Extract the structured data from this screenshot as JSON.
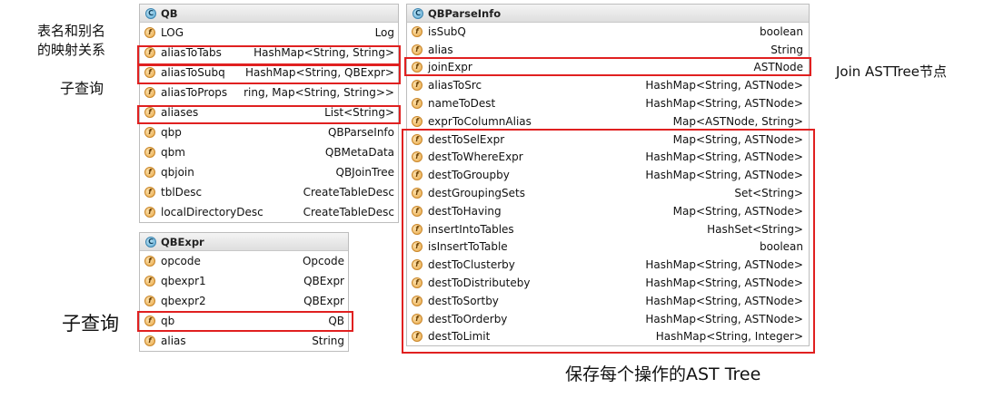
{
  "annotations": {
    "alias_mapping": [
      "表名和别名",
      "的映射关系"
    ],
    "subquery_top": "子查询",
    "subquery_bottom": "子查询",
    "join_node": "Join ASTTree节点",
    "save_each_op": "保存每个操作的AST Tree"
  },
  "panels": {
    "qb": {
      "title": "QB",
      "fields": [
        {
          "name": "LOG",
          "type": "Log"
        },
        {
          "name": "aliasToTabs",
          "type": "HashMap<String, String>"
        },
        {
          "name": "aliasToSubq",
          "type": "HashMap<String, QBExpr>"
        },
        {
          "name": "aliasToProps",
          "type": "ring, Map<String, String>>"
        },
        {
          "name": "aliases",
          "type": "List<String>"
        },
        {
          "name": "qbp",
          "type": "QBParseInfo"
        },
        {
          "name": "qbm",
          "type": "QBMetaData"
        },
        {
          "name": "qbjoin",
          "type": "QBJoinTree"
        },
        {
          "name": "tblDesc",
          "type": "CreateTableDesc"
        },
        {
          "name": "localDirectoryDesc",
          "type": "CreateTableDesc"
        }
      ]
    },
    "qbexpr": {
      "title": "QBExpr",
      "fields": [
        {
          "name": "opcode",
          "type": "Opcode"
        },
        {
          "name": "qbexpr1",
          "type": "QBExpr"
        },
        {
          "name": "qbexpr2",
          "type": "QBExpr"
        },
        {
          "name": "qb",
          "type": "QB"
        },
        {
          "name": "alias",
          "type": "String"
        }
      ]
    },
    "qbparseinfo": {
      "title": "QBParseInfo",
      "fields": [
        {
          "name": "isSubQ",
          "type": "boolean"
        },
        {
          "name": "alias",
          "type": "String"
        },
        {
          "name": "joinExpr",
          "type": "ASTNode"
        },
        {
          "name": "aliasToSrc",
          "type": "HashMap<String, ASTNode>"
        },
        {
          "name": "nameToDest",
          "type": "HashMap<String, ASTNode>"
        },
        {
          "name": "exprToColumnAlias",
          "type": "Map<ASTNode, String>"
        },
        {
          "name": "destToSelExpr",
          "type": "Map<String, ASTNode>"
        },
        {
          "name": "destToWhereExpr",
          "type": "HashMap<String, ASTNode>"
        },
        {
          "name": "destToGroupby",
          "type": "HashMap<String, ASTNode>"
        },
        {
          "name": "destGroupingSets",
          "type": "Set<String>"
        },
        {
          "name": "destToHaving",
          "type": "Map<String, ASTNode>"
        },
        {
          "name": "insertIntoTables",
          "type": "HashSet<String>"
        },
        {
          "name": "isInsertToTable",
          "type": "boolean"
        },
        {
          "name": "destToClusterby",
          "type": "HashMap<String, ASTNode>"
        },
        {
          "name": "destToDistributeby",
          "type": "HashMap<String, ASTNode>"
        },
        {
          "name": "destToSortby",
          "type": "HashMap<String, ASTNode>"
        },
        {
          "name": "destToOrderby",
          "type": "HashMap<String, ASTNode>"
        },
        {
          "name": "destToLimit",
          "type": "HashMap<String, Integer>"
        }
      ]
    }
  },
  "highlight_color": "#e02020",
  "class_icon_letter": "C",
  "field_icon_letter": "f"
}
